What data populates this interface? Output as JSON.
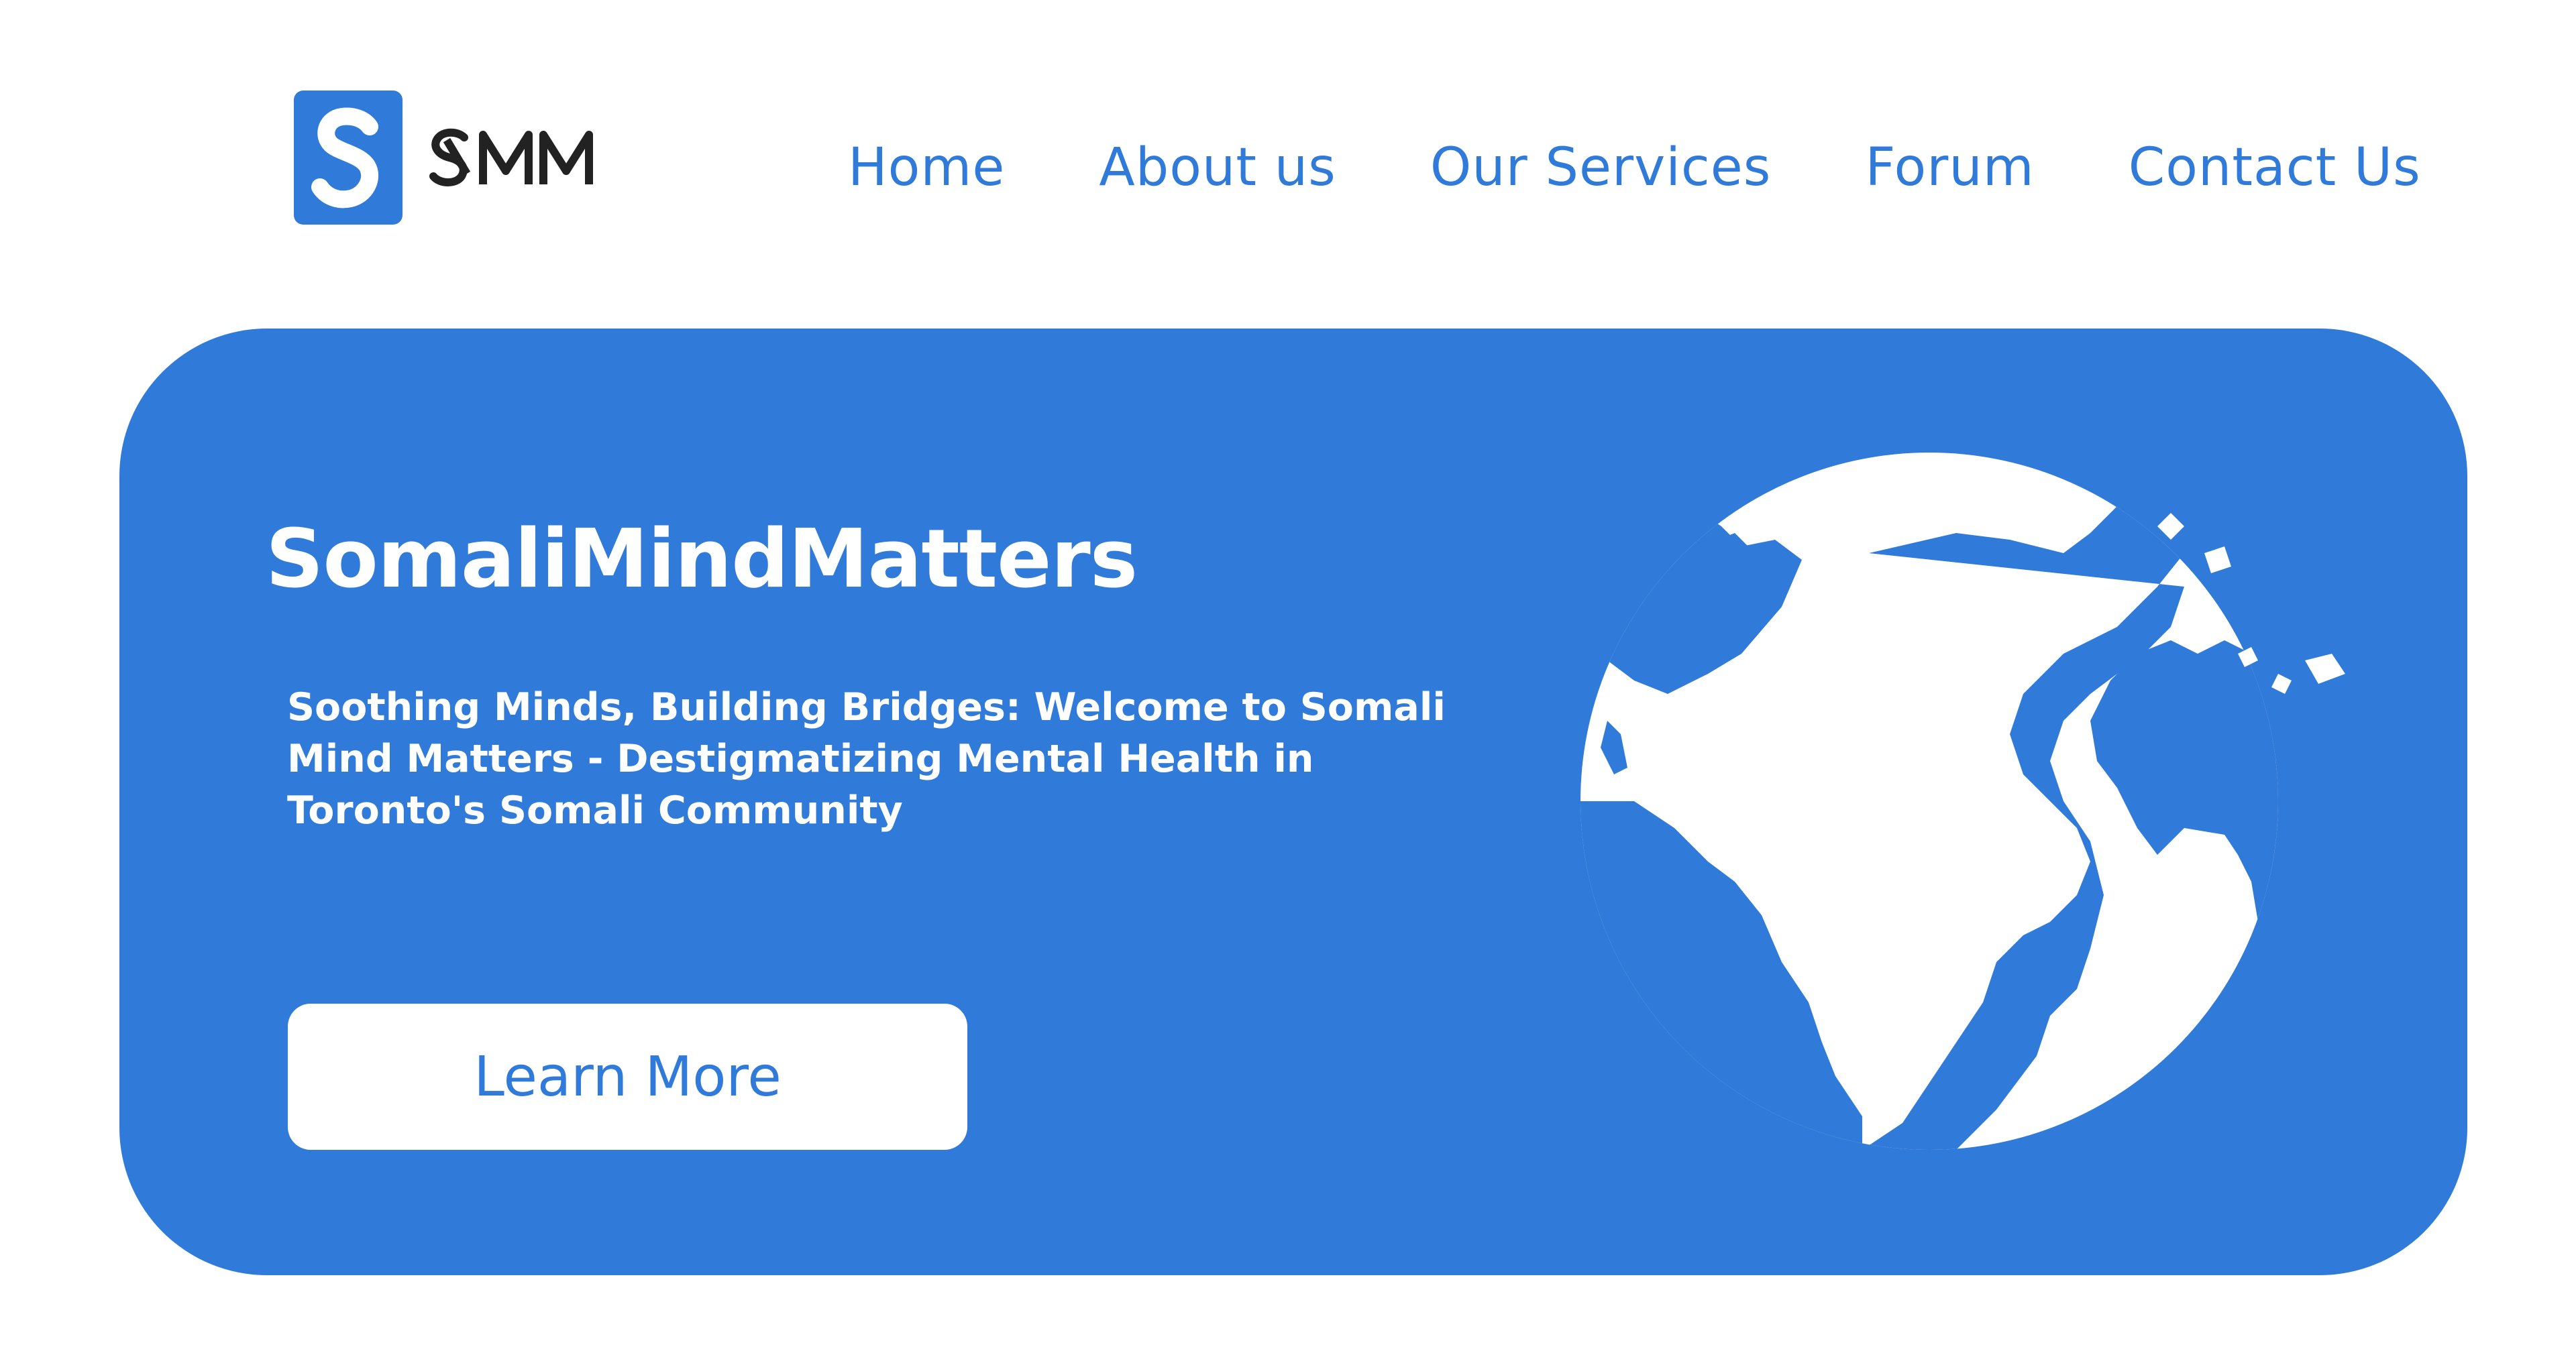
{
  "brand": {
    "logo_letter": "S",
    "logo_word": "SMM",
    "accent": "#307ADA"
  },
  "nav": {
    "items": [
      {
        "label": "Home"
      },
      {
        "label": "About us"
      },
      {
        "label": "Our Services"
      },
      {
        "label": "Forum"
      },
      {
        "label": "Contact Us"
      }
    ]
  },
  "hero": {
    "title": "SomaliMindMatters",
    "subtitle": "Soothing Minds, Building Bridges: Welcome to Somali Mind Matters - Destigmatizing Mental Health in Toronto's Somali Community",
    "cta_label": "Learn More",
    "illustration": "globe-icon"
  }
}
